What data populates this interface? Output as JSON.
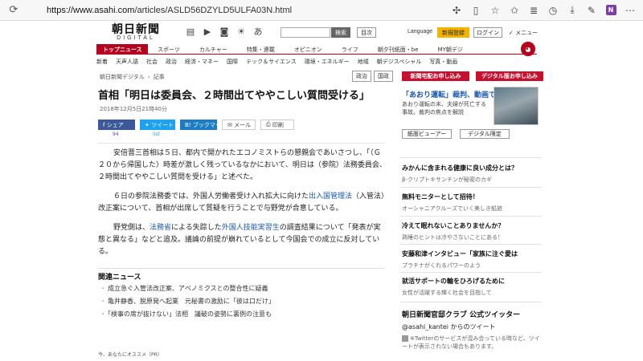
{
  "browser": {
    "url_host": "https://www.asahi.com",
    "url_path": "/articles/ASLD56DZYLD5ULFA03N.html"
  },
  "header": {
    "logo_main": "朝日新聞",
    "logo_sub": "DIGITAL",
    "search_button": "検索",
    "toc_button": "目次",
    "language": "Language",
    "signup": "新規登録",
    "login": "ログイン",
    "menu": "✓ メニュー"
  },
  "topnav": [
    "トップニュース",
    "スポーツ",
    "カルチャー",
    "特集・連載",
    "オピニオン",
    "ライフ",
    "朝夕刊紙面・be",
    "MY朝デジ"
  ],
  "subnav": [
    "新着",
    "天声人語",
    "社会",
    "政治",
    "経済・マネー",
    "国際",
    "テック＆サイエンス",
    "環境・エネルギー",
    "地域",
    "朝デジスペシャル",
    "写真・動画"
  ],
  "breadcrumb": {
    "site": "朝日新聞デジタル",
    "section": "記事",
    "tags": [
      "政治",
      "国政"
    ]
  },
  "article": {
    "headline": "首相「明日は委員会、２時間出てややこしい質問受ける」",
    "date": "2018年12月5日21時40分",
    "share": {
      "facebook": "シェア",
      "facebook_count": "94",
      "twitter": "ツイート",
      "twitter_count": "list",
      "hatena": "ブックマーク",
      "mail": "メール",
      "print": "印刷"
    },
    "p1_a": "　安倍晋三首相は５日、都内で開かれたエコノミストらの懇親会であいさつし、「（Ｇ２０から帰国した）時差が激しく残っているなかにおいて、明日は（参院）法務委員会、２時間出てややこしい質問を受ける」と述べた。",
    "p2_a": "　６日の参院法務委では、外国人労働者受け入れ拡大に向けた",
    "p2_link": "出入国管理法",
    "p2_b": "（入管法）改正案について、首相が出席して質疑を行うことで与野党が合意している。",
    "p3_a": "　野党側は、",
    "p3_link1": "法務省",
    "p3_b": "による失踪した",
    "p3_link2": "外国人技能実習生",
    "p3_c": "の調査結果について「発表が実態と異なる」などと追及。議論の前提が崩れているとして今国会での成立に反対している。"
  },
  "related": {
    "title": "関連ニュース",
    "items": [
      "成立急ぐ入管法改正案、アベノミクスとの整合性に疑義",
      "亀井静香、脱原発へ起業　元秘書の激励に「彼は口だけ」",
      "「検事の席が抜けない」法相　議破の姿勢に裏例の注意も"
    ]
  },
  "pr_label": "今、あなたにオススメ（PR）",
  "sidebar": {
    "red_buttons": [
      "新聞宅配お申し込み",
      "デジタル版お申し込み"
    ],
    "promo_title": "「あおり運転」裁判、動画で",
    "promo_text": "あおり運転の末、夫婦が死亡する事故。裁判の焦点を解説",
    "promo_buttons": [
      "紙面ビューアー",
      "デジタル限定"
    ],
    "ads": [
      {
        "title": "みかんに含まれる健康に良い成分とは？",
        "sub": "β-クリプトキサンチンが秘密のカギ"
      },
      {
        "title": "無料モニターとして招待！",
        "sub": "オーシャニアクルーズでいく美しき船旅"
      },
      {
        "title": "冷えて眠れないことありませんか？",
        "sub": "熟睡のヒントは冷やさないことにある！"
      },
      {
        "title": "安藤和津インタビュー「家族に注ぐ愛は",
        "sub": "プラチナがくれるパワーのよう"
      },
      {
        "title": "就活サポートの輪をひろげるために",
        "sub": "女性が活躍する輝く社会を目指して"
      }
    ],
    "twitter_title": "朝日新聞官邸クラブ 公式ツイッター",
    "twitter_handle": "@asahi_kantei からのツイート",
    "twitter_note": "※Twitterのサービスが混み合っている時など、ツイートが表示されない場合もあります。"
  }
}
